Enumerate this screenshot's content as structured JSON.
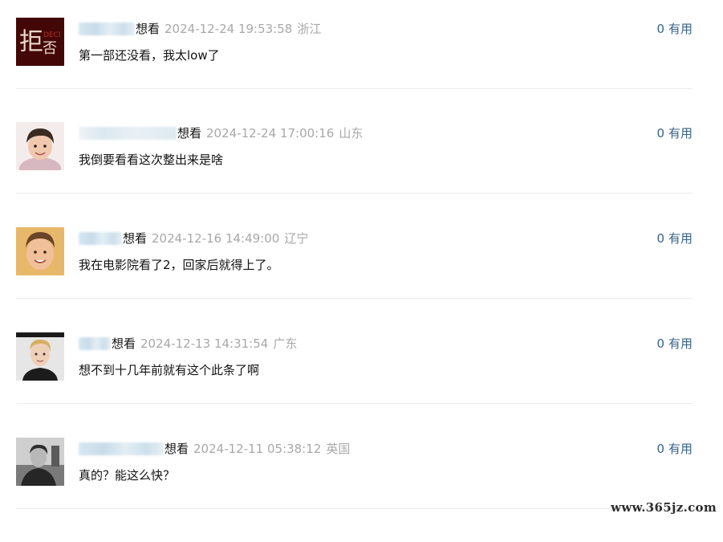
{
  "comments": [
    {
      "avatar": "reject-poster-avatar",
      "username_visible": "",
      "status": "想看",
      "time": "2024-12-24 19:53:58",
      "location": "浙江",
      "useful_count": "0",
      "useful_label": "有用",
      "text": "第一部还没看，我太low了"
    },
    {
      "avatar": "child-portrait-avatar",
      "username_visible": "",
      "status": "想看",
      "time": "2024-12-24 17:00:16",
      "location": "山东",
      "useful_count": "0",
      "useful_label": "有用",
      "text": "我倒要看看这次整出来是啥"
    },
    {
      "avatar": "boy-portrait-avatar",
      "username_visible": "",
      "status": "想看",
      "time": "2024-12-16 14:49:00",
      "location": "辽宁",
      "useful_count": "0",
      "useful_label": "有用",
      "text": "我在电影院看了2，回家后就得上了。"
    },
    {
      "avatar": "blond-man-avatar",
      "username_visible": "",
      "status": "想看",
      "time": "2024-12-13 14:31:54",
      "location": "广东",
      "useful_count": "0",
      "useful_label": "有用",
      "text": "想不到十几年前就有这个此条了啊"
    },
    {
      "avatar": "bw-man-avatar",
      "username_visible": "",
      "status": "想看",
      "time": "2024-12-11 05:38:12",
      "location": "英国",
      "useful_count": "0",
      "useful_label": "有用",
      "text": "真的？能这么快？"
    }
  ],
  "watermark": "www.365jz.com",
  "colors": {
    "link": "#37628a",
    "muted": "#a8a8a8",
    "text": "#111111",
    "divider": "#ececec"
  }
}
